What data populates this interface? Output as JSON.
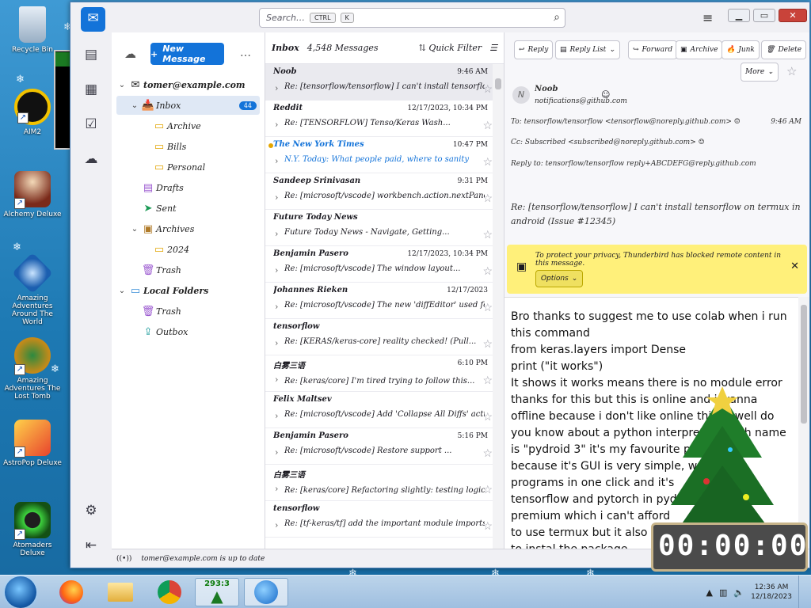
{
  "desktop": {
    "icons": [
      {
        "label": "Recycle Bin",
        "icon": "recycle-bin-icon"
      },
      {
        "label": "AIM2",
        "icon": "aim-icon"
      },
      {
        "label": "Alchemy Deluxe",
        "icon": "wizard-icon"
      },
      {
        "label": "Amazing Adventures Around The World",
        "icon": "diamond-icon"
      },
      {
        "label": "Amazing Adventures The Lost Tomb",
        "icon": "compass-icon"
      },
      {
        "label": "AstroPop Deluxe",
        "icon": "astropop-icon"
      },
      {
        "label": "Atomaders Deluxe",
        "icon": "radiation-icon"
      }
    ]
  },
  "titlebar": {
    "search_placeholder": "Search…",
    "shortcut_ctrl": "CTRL",
    "shortcut_key": "K"
  },
  "folders": {
    "new_message": "New Message",
    "account": "tomer@example.com",
    "items": [
      {
        "label": "Inbox",
        "badge": "44",
        "icon": "inbox-icon"
      },
      {
        "label": "Archive",
        "icon": "folder-icon"
      },
      {
        "label": "Bills",
        "icon": "folder-icon"
      },
      {
        "label": "Personal",
        "icon": "folder-icon"
      },
      {
        "label": "Drafts",
        "icon": "drafts-icon"
      },
      {
        "label": "Sent",
        "icon": "sent-icon"
      },
      {
        "label": "Archives",
        "icon": "archive-icon"
      },
      {
        "label": "2024",
        "icon": "folder-icon"
      },
      {
        "label": "Trash",
        "icon": "trash-icon"
      },
      {
        "label": "Local Folders",
        "icon": "folder-icon"
      },
      {
        "label": "Trash",
        "icon": "trash-icon"
      },
      {
        "label": "Outbox",
        "icon": "outbox-icon"
      }
    ]
  },
  "list": {
    "header_title": "Inbox",
    "header_count": "4,548 Messages",
    "quick_filter": "Quick Filter",
    "messages": [
      {
        "from": "Noob",
        "date": "9:46 AM",
        "subject": "Re: [tensorflow/tensorflow] I can't install tensorflow on termux in android",
        "selected": true
      },
      {
        "from": "Reddit",
        "date": "12/17/2023, 10:34 PM",
        "subject": "Re: [TENSORFLOW] Tenso/Keras Wash..."
      },
      {
        "from": "The New York Times",
        "date": "10:47 PM",
        "subject": "N.Y. Today: What people paid, where to sanity",
        "new": true
      },
      {
        "from": "Sandeep Srinivasan",
        "date": "9:31 PM",
        "subject": "Re: [microsoft/vscode] workbench.action.nextPanelView"
      },
      {
        "from": "Future Today News",
        "date": "",
        "subject": "Future Today News - Navigate, Getting..."
      },
      {
        "from": "Benjamin Pasero",
        "date": "12/17/2023, 10:34 PM",
        "subject": "Re: [microsoft/vscode] The window layout..."
      },
      {
        "from": "Johannes Rieken",
        "date": "12/17/2023",
        "subject": "Re: [microsoft/vscode] The new 'diffEditor' used for..."
      },
      {
        "from": "tensorflow",
        "date": "",
        "subject": "Re: [KERAS/keras-core] reality checked! (Pull..."
      },
      {
        "from": "白雾三语",
        "date": "6:10 PM",
        "subject": "Re: [keras/core] I'm tired trying to follow this..."
      },
      {
        "from": "Felix Maltsev",
        "date": "",
        "subject": "Re: [microsoft/vscode] Add 'Collapse All Diffs' action to..."
      },
      {
        "from": "Benjamin Pasero",
        "date": "5:16 PM",
        "subject": "Re: [microsoft/vscode] Restore support ..."
      },
      {
        "from": "白雾三语",
        "date": "",
        "subject": "Re: [keras/core] Refactoring slightly: testing logic..."
      },
      {
        "from": "tensorflow",
        "date": "",
        "subject": "Re: [tf-keras/tf] add the important module imports..."
      }
    ]
  },
  "reader": {
    "buttons": [
      "Reply",
      "Reply List",
      "Forward",
      "Archive",
      "Junk",
      "Delete",
      "More"
    ],
    "from": "Noob",
    "from_sub": "notifications@github.com",
    "to_label": "To",
    "to": "tensorflow/tensorflow <tensorflow@noreply.github.com>",
    "time": "9:46 AM",
    "cc_label": "Cc",
    "cc": "Subscribed <subscribed@noreply.github.com>",
    "replyto_label": "Reply to",
    "replyto": "tensorflow/tensorflow reply+ABCDEFG@reply.github.com",
    "subject": "Re: [tensorflow/tensorflow] I can't install tensorflow on termux in android (Issue #12345)",
    "remote_notice": "To protect your privacy, Thunderbird has blocked remote content in this message.",
    "options": "Options",
    "body": [
      "Bro thanks to suggest me to use colab when i run",
      "this command",
      "from keras.layers import Dense",
      "print (\"it works\")",
      "It shows it works means there is no module error",
      "thanks for this but this is online and i wanna",
      "offline because i don't like online things well do",
      "you know about a python interpreter which name",
      "is \"pydroid 3\" it's my favourite python",
      "because it's GUI is very simple, we",
      "programs in one click and it's",
      "tensorflow and pytorch in pydroid",
      "premium which i can't afford",
      "to use termux but it also",
      "to instal the package"
    ]
  },
  "status": {
    "text": "tomer@example.com is up to date"
  },
  "taskbar": {
    "counter_badge": "293:3",
    "clock_time": "12:36 AM",
    "clock_date": "12/18/2023",
    "countdown": "00:00:00"
  }
}
